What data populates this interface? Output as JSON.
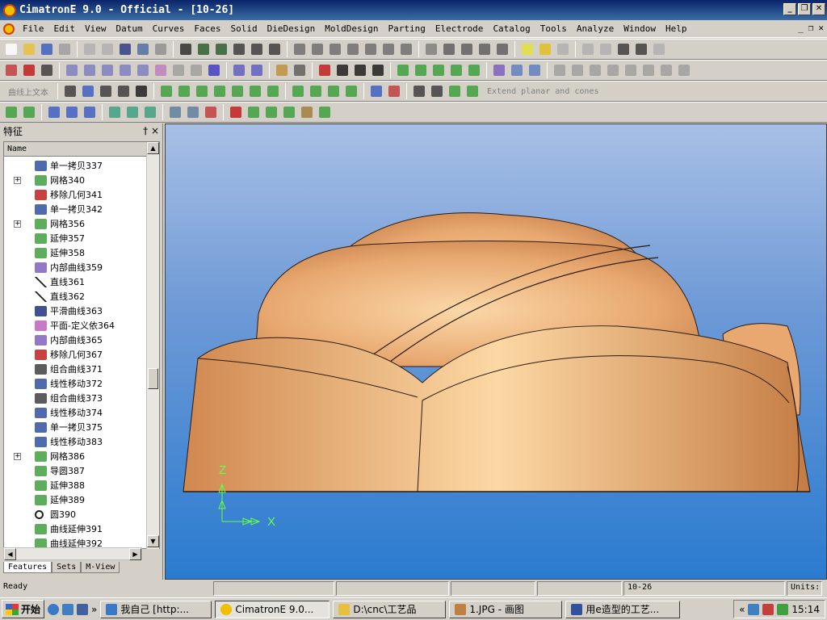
{
  "window": {
    "title": "CimatronE 9.0 - Official - [10-26]"
  },
  "menu": [
    "File",
    "Edit",
    "View",
    "Datum",
    "Curves",
    "Faces",
    "Solid",
    "DieDesign",
    "MoldDesign",
    "Parting",
    "Electrode",
    "Catalog",
    "Tools",
    "Analyze",
    "Window",
    "Help"
  ],
  "toolbar3": {
    "combo_text": "曲线上文本",
    "extend_text": "Extend planar and cones"
  },
  "panel": {
    "title": "特征",
    "pin": "†",
    "close": "×",
    "column": "Name"
  },
  "tree": [
    {
      "label": "单一拷贝337",
      "expand": false,
      "icon": "copy-icon"
    },
    {
      "label": "网格340",
      "expand": true,
      "icon": "mesh-icon"
    },
    {
      "label": "移除几何341",
      "expand": false,
      "icon": "remove-icon"
    },
    {
      "label": "单一拷贝342",
      "expand": false,
      "icon": "copy-icon"
    },
    {
      "label": "网格356",
      "expand": true,
      "icon": "mesh-icon"
    },
    {
      "label": "延伸357",
      "expand": false,
      "icon": "extend-icon"
    },
    {
      "label": "延伸358",
      "expand": false,
      "icon": "extend-icon"
    },
    {
      "label": "内部曲线359",
      "expand": false,
      "icon": "internal-curve-icon"
    },
    {
      "label": "直线361",
      "expand": false,
      "icon": "line-icon"
    },
    {
      "label": "直线362",
      "expand": false,
      "icon": "line-icon"
    },
    {
      "label": "平滑曲线363",
      "expand": false,
      "icon": "smooth-curve-icon"
    },
    {
      "label": "平面-定义依364",
      "expand": false,
      "icon": "plane-icon"
    },
    {
      "label": "内部曲线365",
      "expand": false,
      "icon": "internal-curve-icon"
    },
    {
      "label": "移除几何367",
      "expand": false,
      "icon": "remove-icon"
    },
    {
      "label": "组合曲线371",
      "expand": false,
      "icon": "composite-curve-icon"
    },
    {
      "label": "线性移动372",
      "expand": false,
      "icon": "move-icon"
    },
    {
      "label": "组合曲线373",
      "expand": false,
      "icon": "composite-curve-icon"
    },
    {
      "label": "线性移动374",
      "expand": false,
      "icon": "move-icon"
    },
    {
      "label": "单一拷贝375",
      "expand": false,
      "icon": "copy-icon"
    },
    {
      "label": "线性移动383",
      "expand": false,
      "icon": "move-icon"
    },
    {
      "label": "网格386",
      "expand": true,
      "icon": "mesh-icon"
    },
    {
      "label": "导圆387",
      "expand": false,
      "icon": "fillet-icon"
    },
    {
      "label": "延伸388",
      "expand": false,
      "icon": "extend-icon"
    },
    {
      "label": "延伸389",
      "expand": false,
      "icon": "extend-icon"
    },
    {
      "label": "圆390",
      "expand": false,
      "icon": "circle-icon"
    },
    {
      "label": "曲线延伸391",
      "expand": false,
      "icon": "curve-extend-icon"
    },
    {
      "label": "曲线延伸392",
      "expand": false,
      "icon": "curve-extend-icon"
    }
  ],
  "tabs": [
    "Features",
    "Sets",
    "M-View"
  ],
  "viewport": {
    "axis_z": "Z",
    "axis_x": "X"
  },
  "status": {
    "text": "Ready",
    "doc": "10-26",
    "units": "Units:"
  },
  "taskbar": {
    "start": "开始",
    "more": "»",
    "tasks": [
      "我自己 [http:...",
      "CimatronE 9.0...",
      "D:\\cnc\\工艺品",
      "1.JPG - 画图",
      "用e造型的工艺..."
    ],
    "clock": "15:14",
    "tray_more": "«"
  },
  "colors": {
    "title_dark": "#0a246a",
    "title_light": "#3a6ea5",
    "model": "#e8a870",
    "viewport_bottom": "#2a7bd0",
    "axis": "#66ff44"
  }
}
